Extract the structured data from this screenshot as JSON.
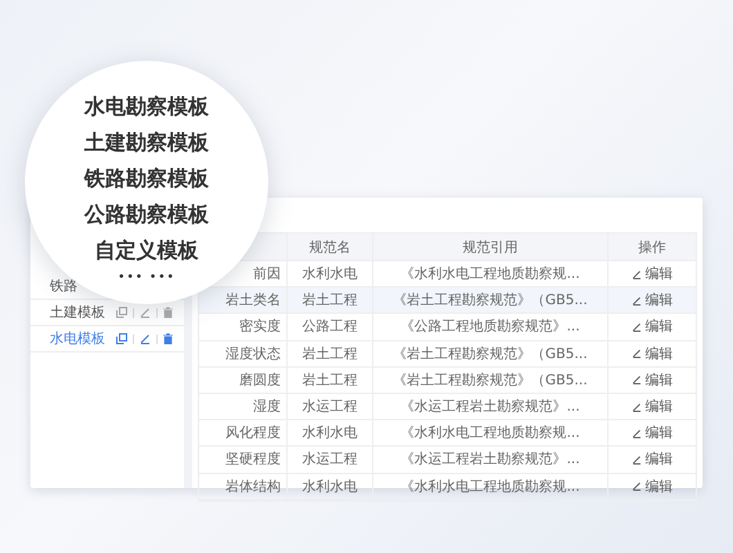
{
  "overlay": {
    "items": [
      "水电勘察模板",
      "土建勘察模板",
      "铁路勘察模板",
      "公路勘察模板",
      "自定义模板"
    ],
    "more": "••• •••"
  },
  "sidebar": {
    "items": [
      {
        "label": "铁路",
        "selected": false,
        "icons": false
      },
      {
        "label": "土建模板",
        "selected": false,
        "icons": true
      },
      {
        "label": "水电模板",
        "selected": true,
        "icons": true
      }
    ]
  },
  "table": {
    "columns": [
      "规范名",
      "规范引用",
      "操作"
    ],
    "rows": [
      {
        "name": "前因",
        "standard": "水利水电",
        "citation": "《水利水电工程地质勘察规...",
        "action": "编辑",
        "selected": false
      },
      {
        "name": "岩土类名",
        "standard": "岩土工程",
        "citation": "《岩土工程勘察规范》（GB5...",
        "action": "编辑",
        "selected": true
      },
      {
        "name": "密实度",
        "standard": "公路工程",
        "citation": "《公路工程地质勘察规范》...",
        "action": "编辑",
        "selected": false
      },
      {
        "name": "湿度状态",
        "standard": "岩土工程",
        "citation": "《岩土工程勘察规范》（GB5...",
        "action": "编辑",
        "selected": false
      },
      {
        "name": "磨圆度",
        "standard": "岩土工程",
        "citation": "《岩土工程勘察规范》（GB5...",
        "action": "编辑",
        "selected": false
      },
      {
        "name": "湿度",
        "standard": "水运工程",
        "citation": "《水运工程岩土勘察规范》...",
        "action": "编辑",
        "selected": false
      },
      {
        "name": "风化程度",
        "standard": "水利水电",
        "citation": "《水利水电工程地质勘察规...",
        "action": "编辑",
        "selected": false
      },
      {
        "name": "坚硬程度",
        "standard": "水运工程",
        "citation": "《水运工程岩土勘察规范》...",
        "action": "编辑",
        "selected": false
      },
      {
        "name": "岩体结构",
        "standard": "水利水电",
        "citation": "《水利水电工程地质勘察规...",
        "action": "编辑",
        "selected": false
      }
    ]
  }
}
